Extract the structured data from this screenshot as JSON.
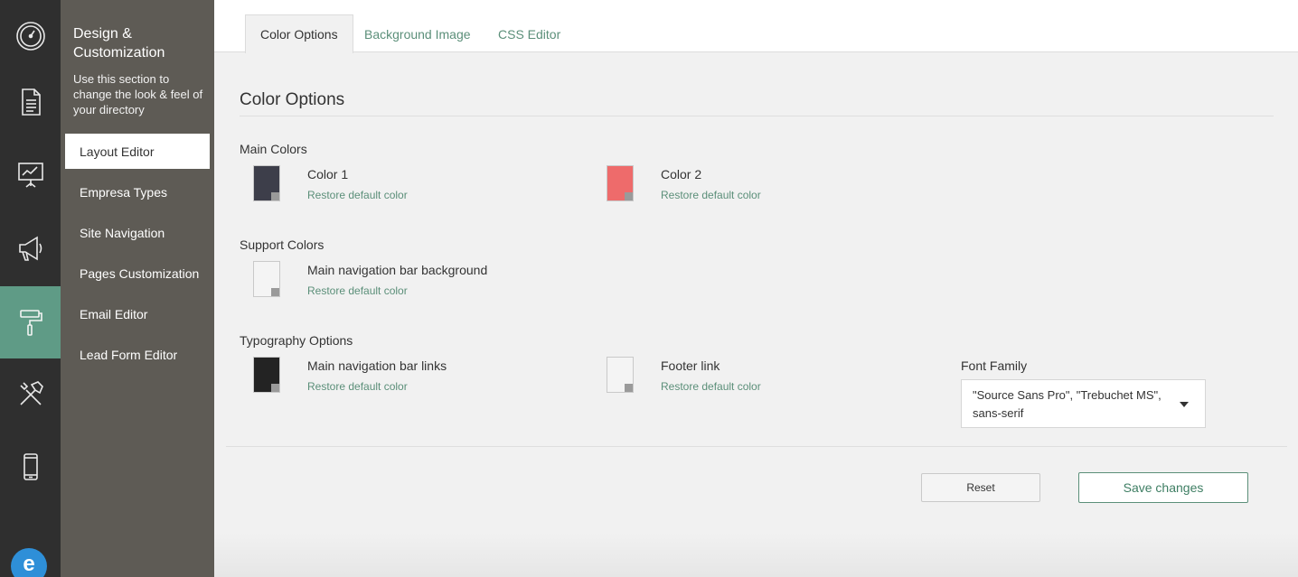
{
  "rail": {
    "items": [
      {
        "icon": "dashboard-icon"
      },
      {
        "icon": "document-icon"
      },
      {
        "icon": "presentation-icon"
      },
      {
        "icon": "megaphone-icon"
      },
      {
        "icon": "paint-roller-icon",
        "active": true
      },
      {
        "icon": "tools-icon"
      },
      {
        "icon": "mobile-icon"
      }
    ],
    "avatar_letter": "e"
  },
  "sidebar": {
    "title": "Design & Customization",
    "description": "Use this section to change the look & feel of your directory",
    "items": [
      {
        "label": "Layout Editor"
      },
      {
        "label": "Empresa Types"
      },
      {
        "label": "Site Navigation"
      },
      {
        "label": "Pages Customization"
      },
      {
        "label": "Email Editor"
      },
      {
        "label": "Lead Form Editor"
      }
    ]
  },
  "tabs": [
    {
      "label": "Color Options"
    },
    {
      "label": "Background Image"
    },
    {
      "label": "CSS Editor"
    }
  ],
  "content": {
    "title": "Color Options",
    "main_colors": {
      "label": "Main Colors",
      "items": [
        {
          "name": "Color 1",
          "restore": "Restore default color",
          "color": "#3d3e4a"
        },
        {
          "name": "Color 2",
          "restore": "Restore default color",
          "color": "#ee6b6b"
        }
      ]
    },
    "support_colors": {
      "label": "Support Colors",
      "items": [
        {
          "name": "Main navigation bar background",
          "restore": "Restore default color",
          "color": "#f4f4f4"
        }
      ]
    },
    "typography": {
      "label": "Typography Options",
      "items": [
        {
          "name": "Main navigation bar links",
          "restore": "Restore default color",
          "color": "#232323"
        },
        {
          "name": "Footer link",
          "restore": "Restore default color",
          "color": "#f4f4f4"
        }
      ],
      "font_family": {
        "label": "Font Family",
        "value": "\"Source Sans Pro\", \"Trebuchet MS\", sans-serif"
      }
    },
    "buttons": {
      "reset": "Reset",
      "save": "Save changes"
    }
  },
  "colors": {
    "accent": "#5f9b86",
    "link": "#5b8f79",
    "rail_bg": "#2f2f2f",
    "sidebar_bg": "#5e5b55"
  }
}
